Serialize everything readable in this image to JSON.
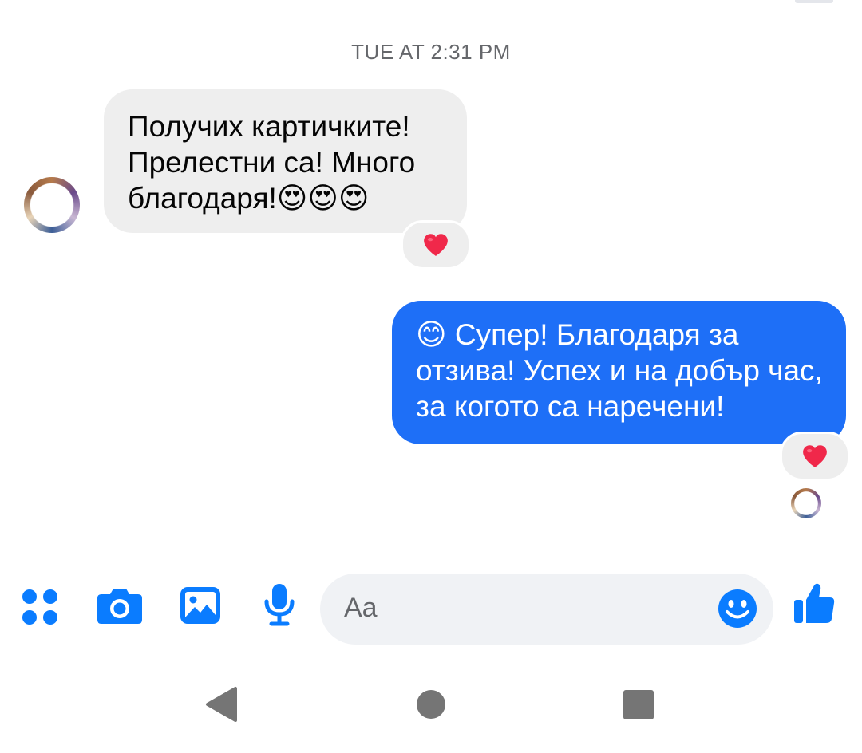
{
  "conversation": {
    "timestamp": "TUE AT 2:31 PM",
    "messages": [
      {
        "direction": "incoming",
        "text": "Получих картичките! Прелестни са! Много благодаря!😍😍😍",
        "reaction": "heart"
      },
      {
        "direction": "outgoing",
        "text": "😊 Супер! Благодаря за отзива! Успех и на добър час, за когото са наречени!",
        "reaction": "heart"
      }
    ]
  },
  "composer": {
    "placeholder": "Aa",
    "tools": [
      "apps-icon",
      "camera-icon",
      "gallery-icon",
      "microphone-icon"
    ],
    "emoji_icon": "smiley-icon",
    "send_icon": "thumbs-up-icon"
  },
  "colors": {
    "outgoing_bubble": "#1e6ff7",
    "incoming_bubble": "#eeeeee",
    "accent": "#0a7cff",
    "reaction_heart": "#f0284a"
  },
  "navigation": [
    "back-icon",
    "home-icon",
    "recents-icon"
  ]
}
